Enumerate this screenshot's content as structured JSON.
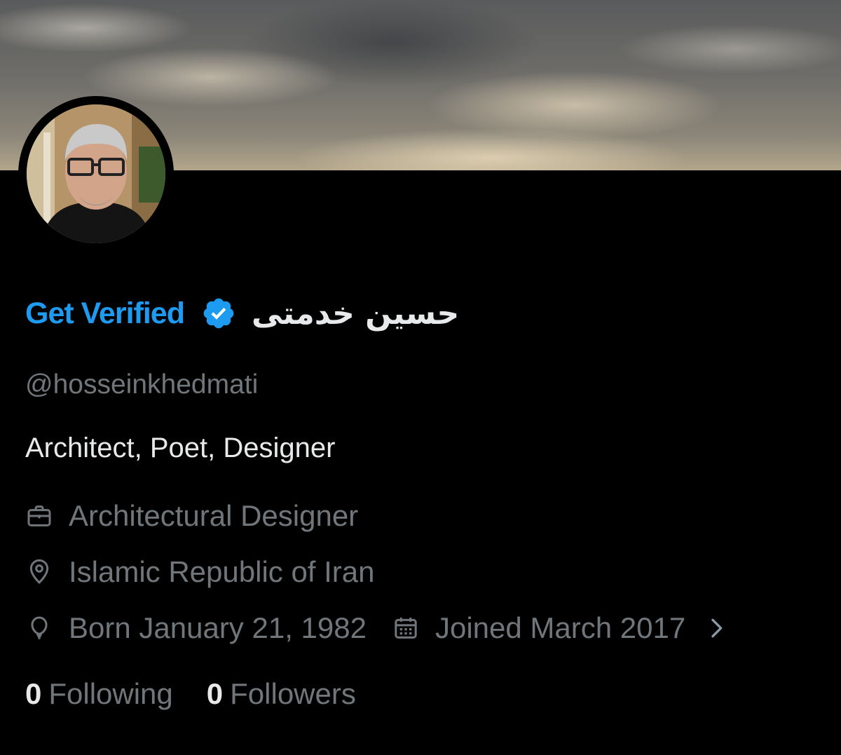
{
  "profile": {
    "get_verified_label": "Get Verified",
    "display_name": "حسین خدمتی",
    "handle": "@hosseinkhedmati",
    "bio": "Architect, Poet, Designer",
    "profession": "Architectural Designer",
    "location": "Islamic Republic of Iran",
    "birthday": "Born January 21, 1982",
    "joined": "Joined March 2017",
    "following_count": "0",
    "following_label": "Following",
    "followers_count": "0",
    "followers_label": "Followers"
  },
  "icons": {
    "profession": "briefcase-icon",
    "location": "location-pin-icon",
    "birthday": "balloon-icon",
    "joined": "calendar-icon",
    "more": "chevron-right-icon",
    "verified": "verified-badge-icon"
  },
  "colors": {
    "background": "#000000",
    "accent": "#1d9bf0",
    "primary_text": "#e7e9ea",
    "secondary_text": "#71767b"
  }
}
